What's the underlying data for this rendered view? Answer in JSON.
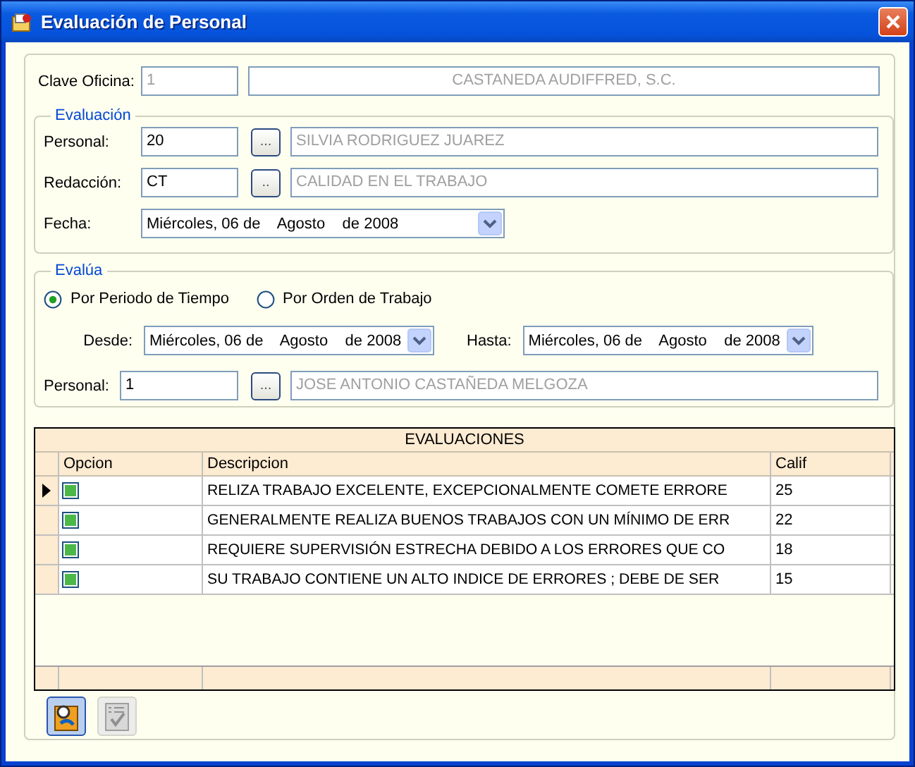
{
  "window": {
    "title": "Evaluación de Personal"
  },
  "office": {
    "label": "Clave Oficina:",
    "code": {
      "value": "1",
      "disabled": true
    },
    "name": {
      "value": "CASTANEDA AUDIFFRED, S.C.",
      "disabled": true
    }
  },
  "evaluacion": {
    "legend": "Evaluación",
    "personal": {
      "label": "Personal:",
      "code": {
        "value": "20",
        "disabled": false
      },
      "browse": "...",
      "name": {
        "value": "SILVIA RODRIGUEZ JUAREZ",
        "disabled": true
      }
    },
    "redaccion": {
      "label": "Redacción:",
      "code": {
        "value": "CT",
        "disabled": false
      },
      "browse": "..",
      "name": {
        "value": "CALIDAD EN EL TRABAJO",
        "disabled": true
      }
    },
    "fecha": {
      "label": "Fecha:",
      "value": "Miércoles, 06 de    Agosto    de 2008"
    }
  },
  "evalua": {
    "legend": "Evalúa",
    "modes": [
      {
        "label": "Por Periodo de Tiempo",
        "selected": true
      },
      {
        "label": "Por Orden de Trabajo",
        "selected": false
      }
    ],
    "desde": {
      "label": "Desde:",
      "value": "Miércoles, 06 de    Agosto    de 2008"
    },
    "hasta": {
      "label": "Hasta:",
      "value": "Miércoles, 06 de    Agosto    de 2008"
    },
    "personal": {
      "label": "Personal:",
      "code": {
        "value": "1",
        "disabled": false
      },
      "browse": "...",
      "name": {
        "value": "JOSE ANTONIO CASTAÑEDA MELGOZA",
        "disabled": true
      }
    }
  },
  "grid": {
    "title": "EVALUACIONES",
    "columns": [
      "Opcion",
      "Descripcion",
      "Calif"
    ],
    "rows": [
      {
        "selected": true,
        "checked": true,
        "description": "RELIZA TRABAJO EXCELENTE, EXCEPCIONALMENTE COMETE ERRORE",
        "calif": "25"
      },
      {
        "selected": false,
        "checked": true,
        "description": "GENERALMENTE REALIZA BUENOS TRABAJOS CON UN MÍNIMO DE ERR",
        "calif": "22"
      },
      {
        "selected": false,
        "checked": true,
        "description": "REQUIERE SUPERVISIÓN ESTRECHA DEBIDO A LOS ERRORES QUE CO",
        "calif": "18"
      },
      {
        "selected": false,
        "checked": true,
        "description": "SU TRABAJO CONTIENE UN ALTO INDICE DE ERRORES ; DEBE DE SER",
        "calif": "15"
      }
    ]
  },
  "toolbar": [
    {
      "kind": "search",
      "disabled": false
    },
    {
      "kind": "checklist",
      "disabled": true
    }
  ]
}
